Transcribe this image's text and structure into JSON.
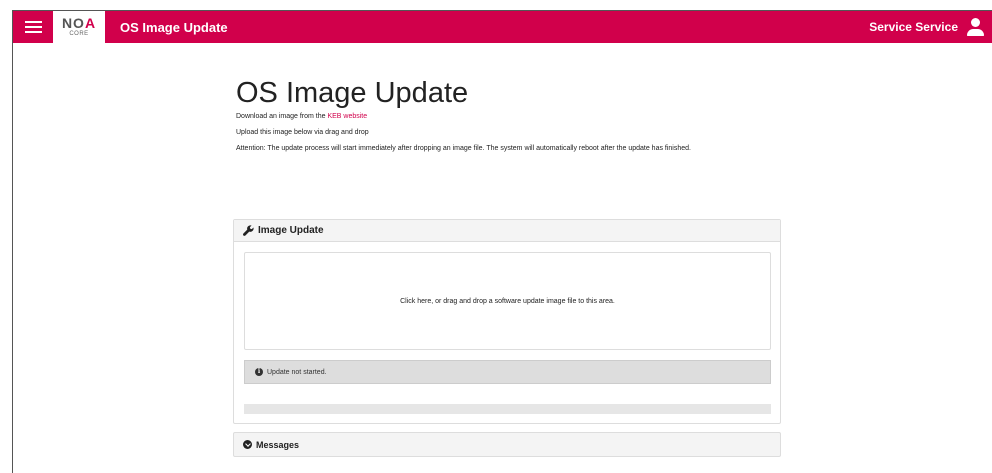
{
  "header": {
    "logo_text": "NOA",
    "logo_sub": "CORE",
    "app_title": "OS Image Update",
    "user_name": "Service Service"
  },
  "main": {
    "title": "OS Image Update",
    "download_prefix": "Download an image from the ",
    "download_link": "KEB website",
    "upload_text": "Upload this image below via drag and drop",
    "attention_text": "Attention: The update process will start immediately after dropping an image file. The system will automatically reboot after the update has finished."
  },
  "image_update_card": {
    "title": "Image Update",
    "dropzone_text": "Click here, or drag and drop a software update image file to this area.",
    "status_text": "Update not started.",
    "progress_percent": 0
  },
  "messages_card": {
    "title": "Messages"
  },
  "colors": {
    "brand": "#d1004b"
  },
  "icons": [
    "hamburger-menu-icon",
    "user-icon",
    "wrench-icon",
    "info-icon",
    "chevron-down-circle-icon"
  ]
}
